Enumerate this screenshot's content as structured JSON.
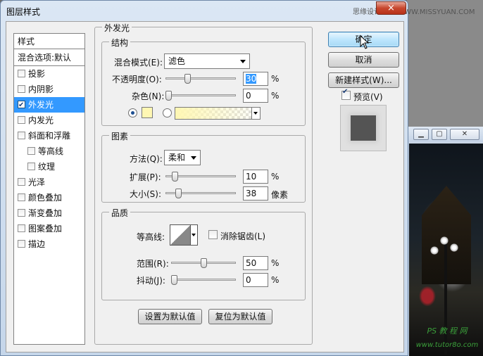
{
  "window": {
    "title": "图层样式",
    "close_glyph": "×",
    "watermark": "思缘设计论坛 WWW.MISSYUAN.COM"
  },
  "style_list": {
    "header": "样式",
    "blend_options": "混合选项:默认",
    "items": [
      {
        "label": "投影",
        "checked": false,
        "sub": false,
        "selected": false
      },
      {
        "label": "内阴影",
        "checked": false,
        "sub": false,
        "selected": false
      },
      {
        "label": "外发光",
        "checked": true,
        "sub": false,
        "selected": true
      },
      {
        "label": "内发光",
        "checked": false,
        "sub": false,
        "selected": false
      },
      {
        "label": "斜面和浮雕",
        "checked": false,
        "sub": false,
        "selected": false
      },
      {
        "label": "等高线",
        "checked": false,
        "sub": true,
        "selected": false
      },
      {
        "label": "纹理",
        "checked": false,
        "sub": true,
        "selected": false
      },
      {
        "label": "光泽",
        "checked": false,
        "sub": false,
        "selected": false
      },
      {
        "label": "颜色叠加",
        "checked": false,
        "sub": false,
        "selected": false
      },
      {
        "label": "渐变叠加",
        "checked": false,
        "sub": false,
        "selected": false
      },
      {
        "label": "图案叠加",
        "checked": false,
        "sub": false,
        "selected": false
      },
      {
        "label": "描边",
        "checked": false,
        "sub": false,
        "selected": false
      }
    ]
  },
  "panel": {
    "title": "外发光",
    "structure": {
      "title": "结构",
      "blend_mode_label": "混合模式(E):",
      "blend_mode_value": "滤色",
      "opacity_label": "不透明度(O):",
      "opacity_value": "30",
      "opacity_level": 30,
      "opacity_unit": "%",
      "noise_label": "杂色(N):",
      "noise_value": "0",
      "noise_level": 0,
      "noise_unit": "%",
      "glow_color": "#fff7b3",
      "color_mode": "solid"
    },
    "elements": {
      "title": "图素",
      "technique_label": "方法(Q):",
      "technique_value": "柔和",
      "spread_label": "扩展(P):",
      "spread_value": "10",
      "spread_level": 10,
      "spread_unit": "%",
      "size_label": "大小(S):",
      "size_value": "38",
      "size_level": 38,
      "size_max": 250,
      "size_unit": "像素"
    },
    "quality": {
      "title": "品质",
      "contour_label": "等高线:",
      "antialias_label": "消除锯齿(L)",
      "antialias_checked": false,
      "range_label": "范围(R):",
      "range_value": "50",
      "range_level": 50,
      "range_unit": "%",
      "jitter_label": "抖动(J):",
      "jitter_value": "0",
      "jitter_level": 0,
      "jitter_unit": "%"
    },
    "set_default": "设置为默认值",
    "reset_default": "复位为默认值"
  },
  "buttons": {
    "ok": "确定",
    "cancel": "取消",
    "new_style": "新建样式(W)...",
    "preview_label": "预览(V)",
    "preview_checked": true
  },
  "background_window": {
    "watermark_line1": "PS 教 程 网",
    "watermark_line2": "www.tutor8o.com"
  },
  "colors": {
    "selection": "#3399ff",
    "dialog_frame": "#c5d6ea",
    "close_button": "#c7472e"
  }
}
